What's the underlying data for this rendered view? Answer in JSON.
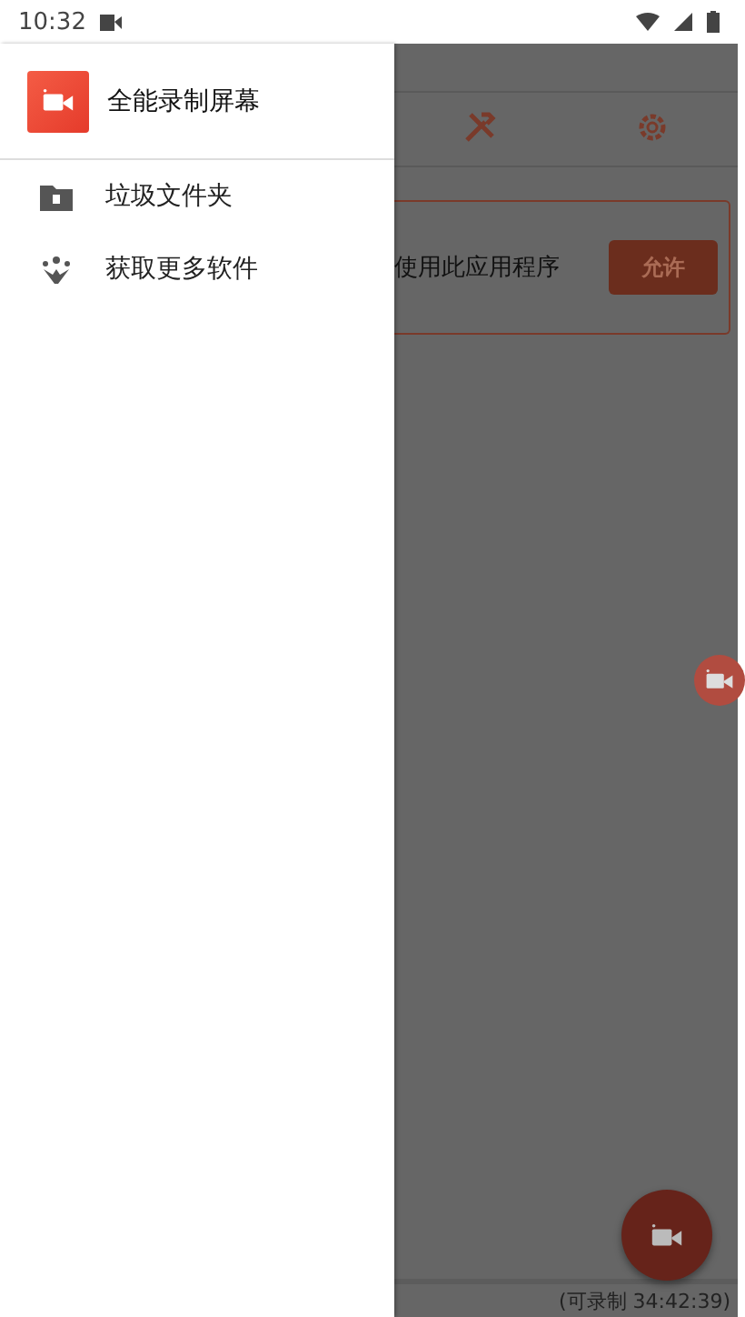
{
  "status_bar": {
    "time": "10:32"
  },
  "drawer": {
    "app_name": "全能录制屏幕",
    "items": [
      {
        "label": "垃圾文件夹",
        "kind": "trash-folder"
      },
      {
        "label": "获取更多软件",
        "kind": "more-apps"
      }
    ]
  },
  "background": {
    "tabs": [
      {
        "kind": "tools",
        "selected": false
      },
      {
        "kind": "settings",
        "selected": false
      }
    ],
    "permission_card": {
      "message": "使用此应用程序",
      "button": "允许"
    },
    "footer": "(可录制 34:42:39)"
  }
}
